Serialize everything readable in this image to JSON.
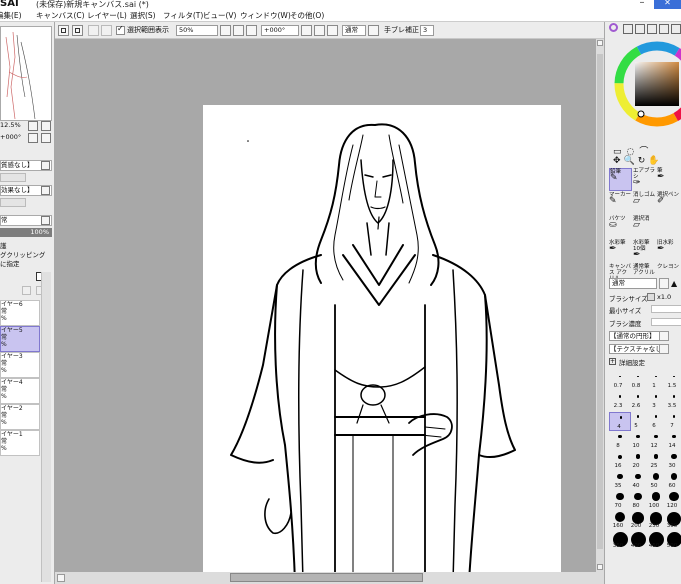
{
  "window": {
    "app_logo": "SAI",
    "title": "(未保存)新規キャンバス.sai (*)",
    "minimize_label": "–",
    "close_label": "✕"
  },
  "menu": [
    "編集(E)",
    "キャンバス(C)",
    "レイヤー(L)",
    "選択(S)",
    "フィルタ(T)",
    "ビュー(V)",
    "ウィンドウ(W)",
    "その他(O)"
  ],
  "toolbar": {
    "show_selection_label": "選択範囲表示",
    "show_selection_checked": true,
    "zoom": "50%",
    "rotation": "+000°",
    "blend": "通常",
    "stabilizer_label": "手ブレ補正",
    "stabilizer_value": "3"
  },
  "navigator": {
    "zoom": "12.5%",
    "angle": "+000°"
  },
  "left_panel": {
    "paper_texture": "質感なし】",
    "paper_effect": "効果なし】",
    "mode": "常",
    "opacity": "100%",
    "preserve_opacity": "護",
    "clipping": "グクリッピング",
    "selection_source": "に指定"
  },
  "layers": [
    {
      "name": "イヤー6",
      "mode": "常",
      "opacity": "%",
      "selected": false
    },
    {
      "name": "イヤー5",
      "mode": "常",
      "opacity": "%",
      "selected": true
    },
    {
      "name": "イヤー3",
      "mode": "常",
      "opacity": "%",
      "selected": false
    },
    {
      "name": "イヤー4",
      "mode": "常",
      "opacity": "%",
      "selected": false
    },
    {
      "name": "イヤー2",
      "mode": "常",
      "opacity": "%",
      "selected": false
    },
    {
      "name": "イヤー1",
      "mode": "常",
      "opacity": "%",
      "selected": false
    }
  ],
  "tools": [
    {
      "label": "鉛筆",
      "selected": true
    },
    {
      "label": "エアブラシ",
      "selected": false
    },
    {
      "label": "筆",
      "selected": false
    },
    {
      "label": "マーカー",
      "selected": false
    },
    {
      "label": "消しゴム",
      "selected": false
    },
    {
      "label": "選択ペン",
      "selected": false
    },
    {
      "label": "バケツ",
      "selected": false
    },
    {
      "label": "選択消",
      "selected": false
    },
    {
      "label": "",
      "selected": false
    },
    {
      "label": "水彩筆",
      "selected": false
    },
    {
      "label": "水彩筆 10個",
      "selected": false
    },
    {
      "label": "旧水彩",
      "selected": false
    },
    {
      "label": "キャンバス アクリル",
      "selected": false
    },
    {
      "label": "通常筆 アクリル",
      "selected": false
    },
    {
      "label": "クレヨン",
      "selected": false
    }
  ],
  "brush": {
    "mode": "通常",
    "size_label": "ブラシサイズ",
    "size_value": "x1.0",
    "min_size_label": "最小サイズ",
    "density_label": "ブラシ濃度",
    "shape": "【通常の円形】",
    "texture": "【テクスチャなし】",
    "details_label": "詳細設定"
  },
  "brush_sizes": [
    "0.7",
    "0.8",
    "1",
    "1.5",
    "2.3",
    "2.6",
    "3",
    "3.5",
    "4",
    "5",
    "6",
    "7",
    "8",
    "10",
    "12",
    "14",
    "16",
    "20",
    "25",
    "30",
    "35",
    "40",
    "50",
    "60",
    "70",
    "80",
    "100",
    "120",
    "160",
    "200",
    "250",
    "300",
    "350",
    "400",
    "450",
    "500"
  ],
  "selected_brush_size": "4",
  "colors": {
    "accent": "#8078cf",
    "selection": "#c9c4f0",
    "canvas_bg": "#a8a8a8"
  }
}
